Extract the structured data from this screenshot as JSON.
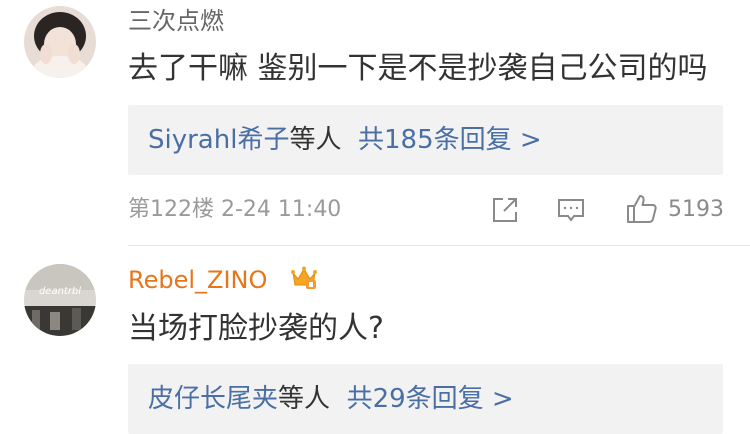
{
  "comments": [
    {
      "username": "三次点燃",
      "content": "去了干嘛 鉴别一下是不是抄袭自己公司的吗",
      "reply_names": "Siyrahl希子",
      "reply_suffix": "等人",
      "reply_count": "共185条回复 >",
      "floor_time": "第122楼 2-24 11:40",
      "like_count": "5193"
    },
    {
      "username": "Rebel_ZINO",
      "content": "当场打脸抄袭的人?",
      "reply_names": "皮仔长尾夹",
      "reply_suffix": "等人",
      "reply_count": "共29条回复 >",
      "avatar_text": "deantrbl"
    }
  ],
  "colors": {
    "username_default": "#666666",
    "username_vip": "#e6761a",
    "link_blue": "#4a6fa5",
    "meta_gray": "#9a9a9a",
    "reply_bg": "#f2f2f2"
  },
  "icons": [
    "share-icon",
    "comment-icon",
    "like-icon",
    "crown-badge-icon"
  ]
}
